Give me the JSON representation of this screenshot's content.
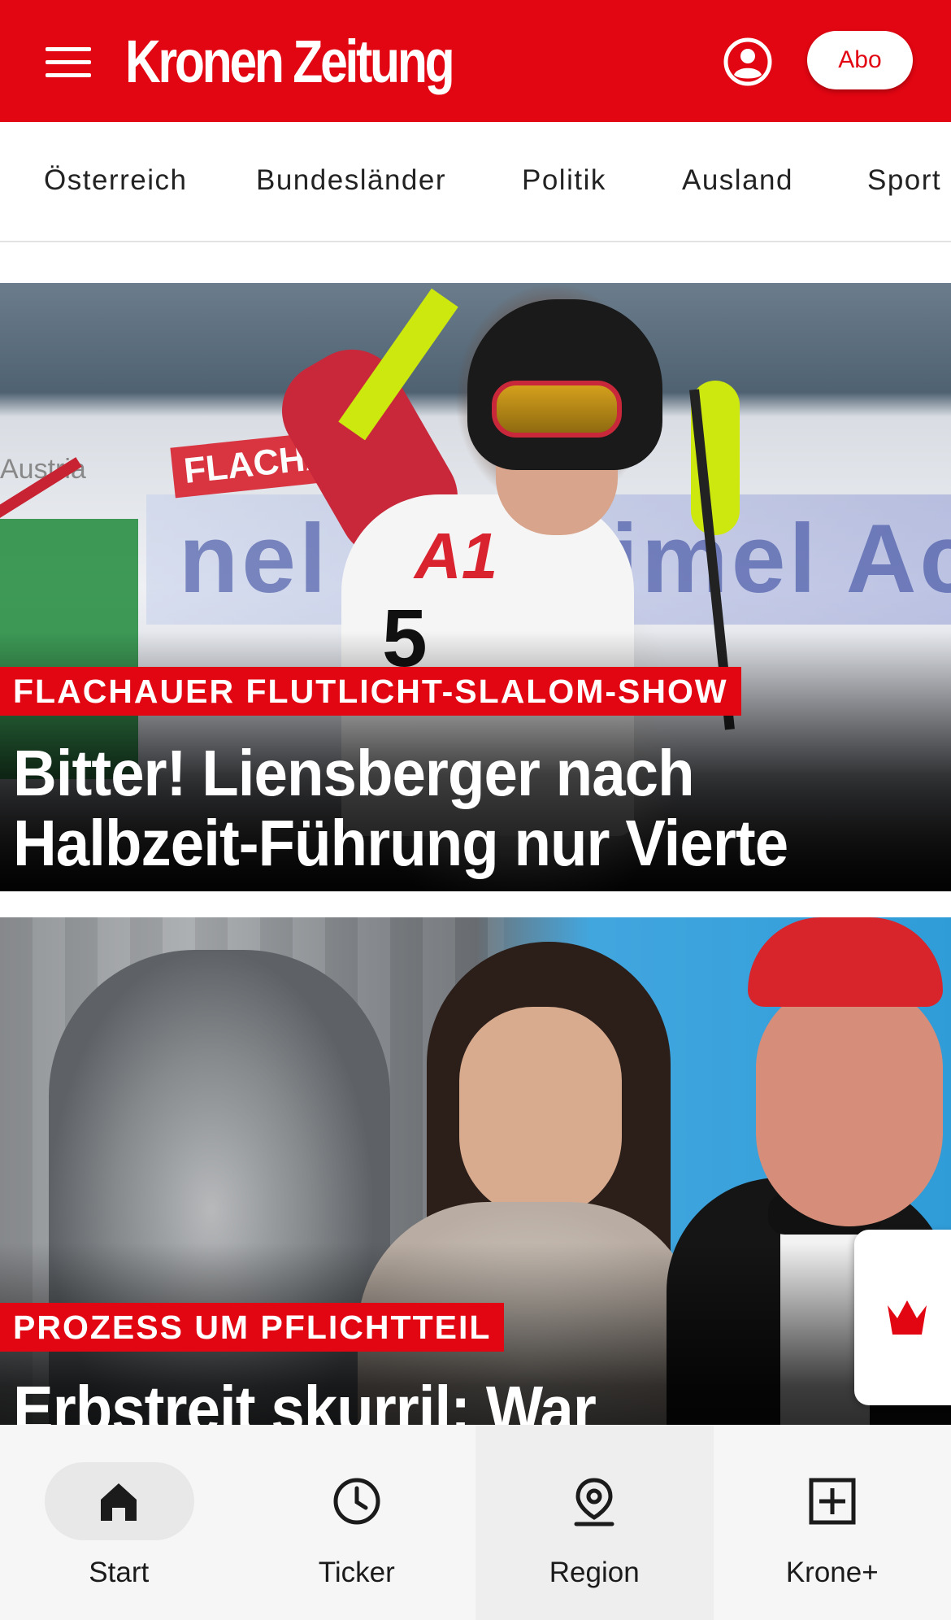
{
  "header": {
    "logo_text": "Kronen Zeitung",
    "abo_label": "Abo",
    "brand_color": "#e10612"
  },
  "nav": {
    "items": [
      {
        "label": "Österreich"
      },
      {
        "label": "Bundesländer"
      },
      {
        "label": "Politik"
      },
      {
        "label": "Ausland"
      },
      {
        "label": "Sport"
      }
    ]
  },
  "articles": [
    {
      "kicker": "FLACHAUER FLUTLICHT-SLALOM-SHOW",
      "headline_line1": "Bitter! Liensberger nach",
      "headline_line2": "Halbzeit-Führung nur Vierte",
      "image_text": {
        "banner": "nel Ac    ctimel Ac",
        "sign": "FLACHAU",
        "austria": "Austria",
        "bib_logo": "A1",
        "bib_number": "5"
      }
    },
    {
      "kicker": "PROZESS UM PFLICHTTEIL",
      "headline_line1": "Erbstreit skurril: War",
      "headline_line2": ""
    }
  ],
  "bottom_nav": {
    "items": [
      {
        "label": "Start",
        "icon": "home-icon",
        "active": true
      },
      {
        "label": "Ticker",
        "icon": "clock-icon"
      },
      {
        "label": "Region",
        "icon": "location-pin-icon"
      },
      {
        "label": "Krone+",
        "icon": "plus-box-icon"
      }
    ]
  },
  "icons": {
    "menu": "hamburger-menu-icon",
    "user": "user-account-icon",
    "side_tab": "crown-icon"
  }
}
